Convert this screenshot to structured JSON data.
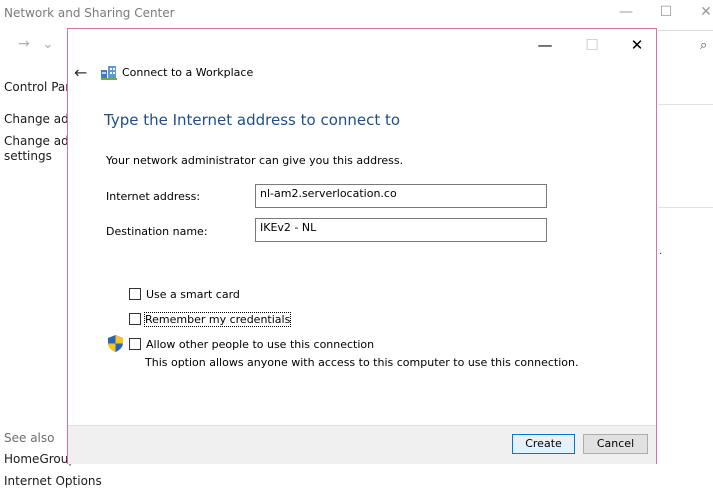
{
  "background_window": {
    "title": "Network and Sharing Center",
    "controls": {
      "minimize": "—",
      "maximize": "☐",
      "close": "✕"
    },
    "nav_back": "→",
    "nav_dropdown": "⌄",
    "search_icon": "⌕",
    "sidebar": {
      "control_panel_home": "Control Pane",
      "change_adapter": "Change adap",
      "change_advanced_line1": "Change adva",
      "change_advanced_line2": "settings",
      "see_also": "See also",
      "homegroup": "HomeGroup",
      "internet_options": "Internet Options"
    },
    "stray_dot": "."
  },
  "dialog": {
    "controls": {
      "minimize": "—",
      "maximize": "☐",
      "close": "✕"
    },
    "back_arrow": "←",
    "app_title": "Connect to a Workplace",
    "heading": "Type the Internet address to connect to",
    "description": "Your network administrator can give you this address.",
    "internet_address_label": "Internet address:",
    "internet_address_value": "nl-am2.serverlocation.co",
    "destination_name_label": "Destination name:",
    "destination_name_value": "IKEv2 - NL",
    "options": {
      "smart_card": {
        "label": "Use a smart card",
        "checked": false
      },
      "remember_credentials": {
        "label": "Remember my credentials",
        "checked": false
      },
      "allow_others": {
        "label": "Allow other people to use this connection",
        "checked": false
      }
    },
    "allow_note": "This option allows anyone with access to this computer to use this connection.",
    "buttons": {
      "create": "Create",
      "cancel": "Cancel"
    },
    "colors": {
      "heading": "#1f4e8c",
      "border": "#d670a8",
      "primary_border": "#0078d7"
    }
  }
}
